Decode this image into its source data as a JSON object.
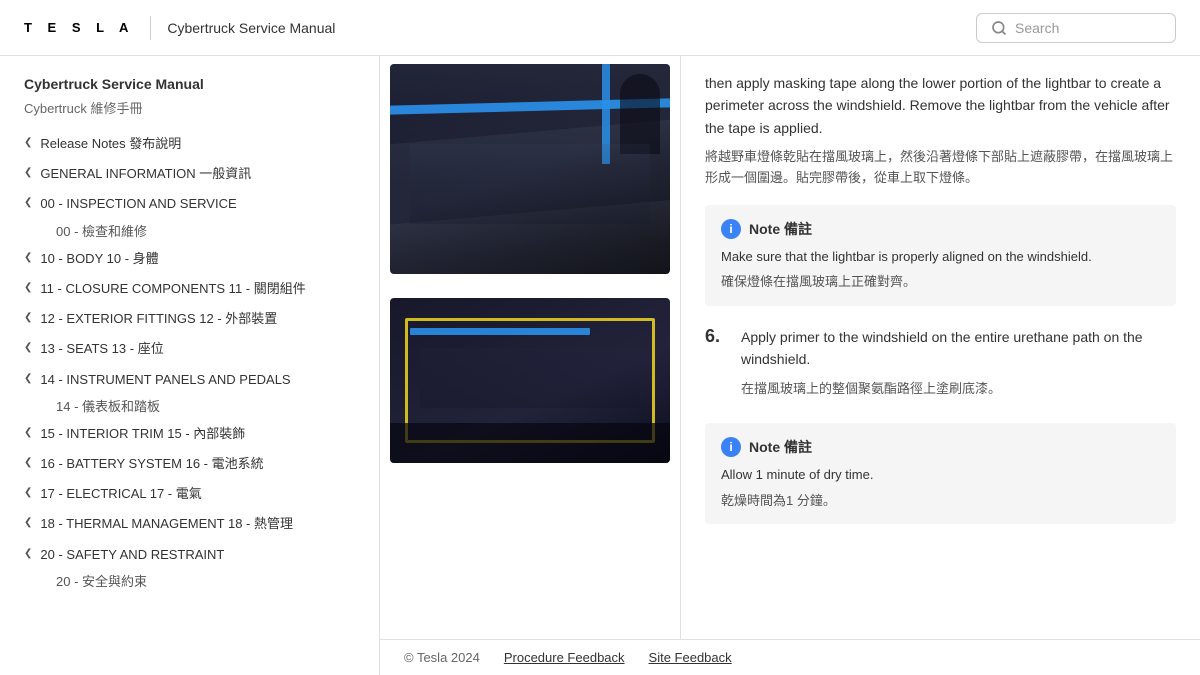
{
  "header": {
    "logo": "T E S L A",
    "title": "Cybertruck Service Manual",
    "search_placeholder": "Search"
  },
  "sidebar": {
    "manual_title": "Cybertruck Service Manual",
    "manual_subtitle": "Cybertruck 維修手冊",
    "items": [
      {
        "id": "release-notes",
        "label": "Release Notes 發布說明",
        "has_chevron": true
      },
      {
        "id": "general-info",
        "label": "GENERAL INFORMATION 一般資訊",
        "has_chevron": true
      },
      {
        "id": "inspection",
        "label": "00 - INSPECTION AND SERVICE",
        "has_chevron": true,
        "sub": "00 - 檢查和維修"
      },
      {
        "id": "body",
        "label": "10 - BODY 10 - 身體",
        "has_chevron": true
      },
      {
        "id": "closure",
        "label": "11 - CLOSURE COMPONENTS 11 - 關閉組件",
        "has_chevron": true
      },
      {
        "id": "exterior",
        "label": "12 - EXTERIOR FITTINGS 12 - 外部裝置",
        "has_chevron": true
      },
      {
        "id": "seats",
        "label": "13 - SEATS 13 - 座位",
        "has_chevron": true
      },
      {
        "id": "instrument",
        "label": "14 - INSTRUMENT PANELS AND PEDALS",
        "has_chevron": true,
        "sub": "14 - 儀表板和踏板"
      },
      {
        "id": "interior",
        "label": "15 - INTERIOR TRIM 15 - 內部裝飾",
        "has_chevron": true
      },
      {
        "id": "battery",
        "label": "16 - BATTERY SYSTEM 16 - 電池系統",
        "has_chevron": true
      },
      {
        "id": "electrical",
        "label": "17 - ELECTRICAL 17 - 電氣",
        "has_chevron": true
      },
      {
        "id": "thermal",
        "label": "18 - THERMAL MANAGEMENT 18 - 熱管理",
        "has_chevron": true
      },
      {
        "id": "safety",
        "label": "20 - SAFETY AND RESTRAINT",
        "has_chevron": true,
        "sub": "20 - 安全與約束"
      }
    ]
  },
  "content": {
    "intro_text_en": "then apply masking tape along the lower portion of the lightbar to create a perimeter across the windshield. Remove the lightbar from the vehicle after the tape is applied.",
    "intro_text_zh": "將越野車燈條乾貼在擋風玻璃上，然後沿著燈條下部貼上遮蔽膠帶，在擋風玻璃上形成一個圍邊。貼完膠帶後，從車上取下燈條。",
    "note1": {
      "label": "Note 備註",
      "text_en": "Make sure that the lightbar is properly aligned on the windshield.",
      "text_zh": "確保燈條在擋風玻璃上正確對齊。"
    },
    "step6": {
      "number": "6.",
      "text_en": "Apply primer to the windshield on the entire urethane path on the windshield.",
      "text_zh": "在擋風玻璃上的整個聚氨酯路徑上塗刷底漆。"
    },
    "note2": {
      "label": "Note 備註",
      "text_en": "Allow 1 minute of dry time.",
      "text_zh": "乾燥時間為1 分鐘。"
    }
  },
  "footer": {
    "copyright": "© Tesla 2024",
    "procedure_feedback": "Procedure Feedback",
    "site_feedback": "Site Feedback"
  }
}
